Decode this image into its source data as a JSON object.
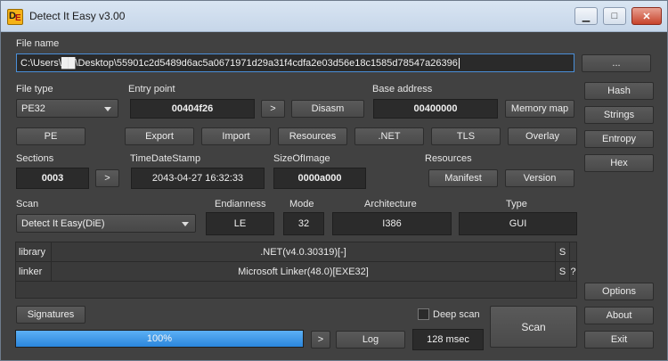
{
  "window": {
    "title": "Detect It Easy v3.00"
  },
  "file": {
    "label": "File name",
    "path": "C:\\Users\\██\\Desktop\\55901c2d5489d6ac5a0671971d29a31f4cdfa2e03d56e18c1585d78547a26396",
    "browse_label": "..."
  },
  "file_type": {
    "label": "File type",
    "value": "PE32"
  },
  "entry_point": {
    "label": "Entry point",
    "value": "00404f26",
    "go_label": ">",
    "disasm_label": "Disasm"
  },
  "base_address": {
    "label": "Base address",
    "value": "00400000",
    "memory_map_label": "Memory map"
  },
  "sections_row": [
    "PE",
    "Export",
    "Import",
    "Resources",
    ".NET",
    "TLS",
    "Overlay"
  ],
  "sections": {
    "label": "Sections",
    "value": "0003",
    "go_label": ">"
  },
  "timestamp": {
    "label": "TimeDateStamp",
    "value": "2043-04-27 16:32:33"
  },
  "image_size": {
    "label": "SizeOfImage",
    "value": "0000a000"
  },
  "resources": {
    "label": "Resources",
    "manifest_label": "Manifest",
    "version_label": "Version"
  },
  "scan": {
    "label": "Scan",
    "engine": "Detect It Easy(DiE)",
    "endianness_label": "Endianness",
    "endianness": "LE",
    "mode_label": "Mode",
    "mode": "32",
    "arch_label": "Architecture",
    "arch": "I386",
    "type_label": "Type",
    "type": "GUI"
  },
  "results": [
    {
      "kind": "library",
      "name": ".NET(v4.0.30319)[-]",
      "flag": "S",
      "extra": ""
    },
    {
      "kind": "linker",
      "name": "Microsoft Linker(48.0)[EXE32]",
      "flag": "S",
      "extra": "?"
    }
  ],
  "bottom": {
    "signatures_label": "Signatures",
    "deep_scan_label": "Deep scan",
    "deep_scan_checked": false,
    "scan_label": "Scan",
    "progress": 100,
    "progress_text": "100%",
    "expand_label": ">",
    "log_label": "Log",
    "elapsed": "128 msec"
  },
  "side_buttons": {
    "hash": "Hash",
    "strings": "Strings",
    "entropy": "Entropy",
    "hex": "Hex",
    "options": "Options",
    "about": "About",
    "exit": "Exit"
  },
  "colors": {
    "progress": "#2b86dc",
    "background": "#414141",
    "focus": "#4a8fd9"
  }
}
